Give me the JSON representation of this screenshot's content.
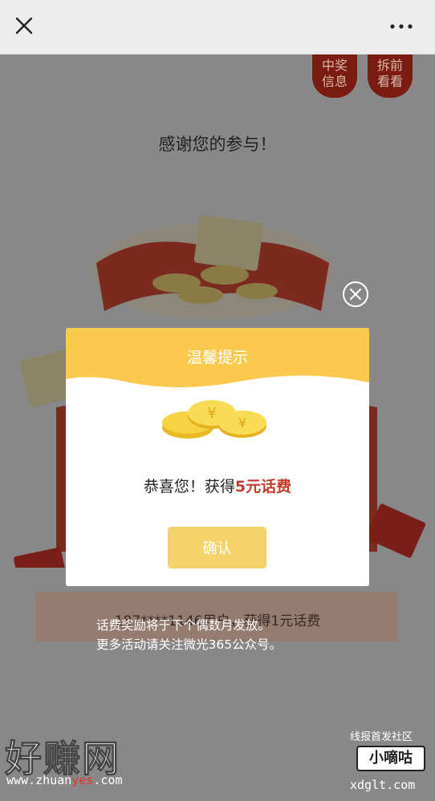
{
  "page": {
    "tabs": [
      {
        "label_line1": "中奖",
        "label_line2": "信息"
      },
      {
        "label_line1": "拆前",
        "label_line2": "看看"
      }
    ],
    "thanks": "感谢您的参与！",
    "winner": "187****1146用户，获得1元话费",
    "notice_line1": "话费奖励将于下个偶数月发放。",
    "notice_line2": "更多活动请关注微光365公众号。"
  },
  "modal": {
    "title": "温馨提示",
    "congrats_prefix": "恭喜您！获得",
    "prize": "5元话费",
    "confirm_label": "确认"
  },
  "watermark": {
    "left_main": "好赚网",
    "left_sub_a": "www.zhuan",
    "left_sub_b": "yes",
    "left_sub_c": ".com",
    "right_top": "线报首发社区",
    "right_badge": "小嘀咕",
    "right_bottom": "xdglt.com"
  },
  "colors": {
    "topbar": "#ededed",
    "overlay": "#888888",
    "modal_header": "#fbc94f",
    "confirm": "#f6d26a",
    "prize_red": "#c23b2c"
  },
  "icons": {
    "close": "close-icon",
    "more": "more-dots-icon",
    "modal_close": "circle-close-icon"
  }
}
